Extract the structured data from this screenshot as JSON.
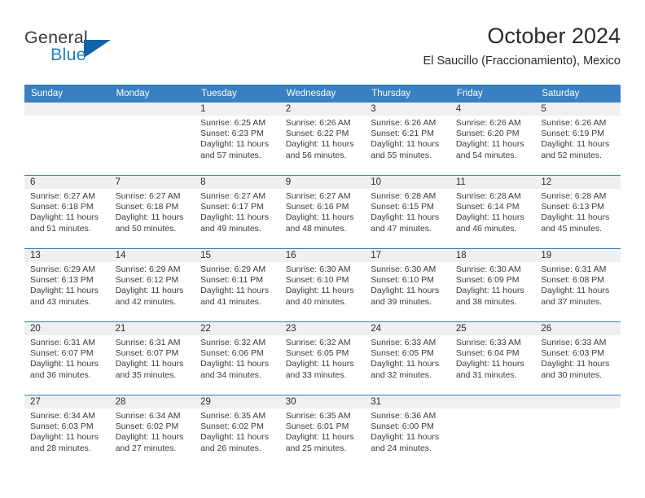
{
  "brand": {
    "line1": "General",
    "line2": "Blue",
    "triangle_icon": "triangle-icon",
    "accent_color": "#1263a8"
  },
  "header": {
    "month_title": "October 2024",
    "location": "El Saucillo (Fraccionamiento), Mexico"
  },
  "calendar": {
    "header_bg": "#3a7fc1",
    "daynum_bg": "#f0f0f0",
    "weekday_headers": [
      "Sunday",
      "Monday",
      "Tuesday",
      "Wednesday",
      "Thursday",
      "Friday",
      "Saturday"
    ],
    "weeks": [
      [
        {
          "day": "",
          "sunrise": "",
          "sunset": "",
          "daylight1": "",
          "daylight2": ""
        },
        {
          "day": "",
          "sunrise": "",
          "sunset": "",
          "daylight1": "",
          "daylight2": ""
        },
        {
          "day": "1",
          "sunrise": "Sunrise: 6:25 AM",
          "sunset": "Sunset: 6:23 PM",
          "daylight1": "Daylight: 11 hours",
          "daylight2": "and 57 minutes."
        },
        {
          "day": "2",
          "sunrise": "Sunrise: 6:26 AM",
          "sunset": "Sunset: 6:22 PM",
          "daylight1": "Daylight: 11 hours",
          "daylight2": "and 56 minutes."
        },
        {
          "day": "3",
          "sunrise": "Sunrise: 6:26 AM",
          "sunset": "Sunset: 6:21 PM",
          "daylight1": "Daylight: 11 hours",
          "daylight2": "and 55 minutes."
        },
        {
          "day": "4",
          "sunrise": "Sunrise: 6:26 AM",
          "sunset": "Sunset: 6:20 PM",
          "daylight1": "Daylight: 11 hours",
          "daylight2": "and 54 minutes."
        },
        {
          "day": "5",
          "sunrise": "Sunrise: 6:26 AM",
          "sunset": "Sunset: 6:19 PM",
          "daylight1": "Daylight: 11 hours",
          "daylight2": "and 52 minutes."
        }
      ],
      [
        {
          "day": "6",
          "sunrise": "Sunrise: 6:27 AM",
          "sunset": "Sunset: 6:18 PM",
          "daylight1": "Daylight: 11 hours",
          "daylight2": "and 51 minutes."
        },
        {
          "day": "7",
          "sunrise": "Sunrise: 6:27 AM",
          "sunset": "Sunset: 6:18 PM",
          "daylight1": "Daylight: 11 hours",
          "daylight2": "and 50 minutes."
        },
        {
          "day": "8",
          "sunrise": "Sunrise: 6:27 AM",
          "sunset": "Sunset: 6:17 PM",
          "daylight1": "Daylight: 11 hours",
          "daylight2": "and 49 minutes."
        },
        {
          "day": "9",
          "sunrise": "Sunrise: 6:27 AM",
          "sunset": "Sunset: 6:16 PM",
          "daylight1": "Daylight: 11 hours",
          "daylight2": "and 48 minutes."
        },
        {
          "day": "10",
          "sunrise": "Sunrise: 6:28 AM",
          "sunset": "Sunset: 6:15 PM",
          "daylight1": "Daylight: 11 hours",
          "daylight2": "and 47 minutes."
        },
        {
          "day": "11",
          "sunrise": "Sunrise: 6:28 AM",
          "sunset": "Sunset: 6:14 PM",
          "daylight1": "Daylight: 11 hours",
          "daylight2": "and 46 minutes."
        },
        {
          "day": "12",
          "sunrise": "Sunrise: 6:28 AM",
          "sunset": "Sunset: 6:13 PM",
          "daylight1": "Daylight: 11 hours",
          "daylight2": "and 45 minutes."
        }
      ],
      [
        {
          "day": "13",
          "sunrise": "Sunrise: 6:29 AM",
          "sunset": "Sunset: 6:13 PM",
          "daylight1": "Daylight: 11 hours",
          "daylight2": "and 43 minutes."
        },
        {
          "day": "14",
          "sunrise": "Sunrise: 6:29 AM",
          "sunset": "Sunset: 6:12 PM",
          "daylight1": "Daylight: 11 hours",
          "daylight2": "and 42 minutes."
        },
        {
          "day": "15",
          "sunrise": "Sunrise: 6:29 AM",
          "sunset": "Sunset: 6:11 PM",
          "daylight1": "Daylight: 11 hours",
          "daylight2": "and 41 minutes."
        },
        {
          "day": "16",
          "sunrise": "Sunrise: 6:30 AM",
          "sunset": "Sunset: 6:10 PM",
          "daylight1": "Daylight: 11 hours",
          "daylight2": "and 40 minutes."
        },
        {
          "day": "17",
          "sunrise": "Sunrise: 6:30 AM",
          "sunset": "Sunset: 6:10 PM",
          "daylight1": "Daylight: 11 hours",
          "daylight2": "and 39 minutes."
        },
        {
          "day": "18",
          "sunrise": "Sunrise: 6:30 AM",
          "sunset": "Sunset: 6:09 PM",
          "daylight1": "Daylight: 11 hours",
          "daylight2": "and 38 minutes."
        },
        {
          "day": "19",
          "sunrise": "Sunrise: 6:31 AM",
          "sunset": "Sunset: 6:08 PM",
          "daylight1": "Daylight: 11 hours",
          "daylight2": "and 37 minutes."
        }
      ],
      [
        {
          "day": "20",
          "sunrise": "Sunrise: 6:31 AM",
          "sunset": "Sunset: 6:07 PM",
          "daylight1": "Daylight: 11 hours",
          "daylight2": "and 36 minutes."
        },
        {
          "day": "21",
          "sunrise": "Sunrise: 6:31 AM",
          "sunset": "Sunset: 6:07 PM",
          "daylight1": "Daylight: 11 hours",
          "daylight2": "and 35 minutes."
        },
        {
          "day": "22",
          "sunrise": "Sunrise: 6:32 AM",
          "sunset": "Sunset: 6:06 PM",
          "daylight1": "Daylight: 11 hours",
          "daylight2": "and 34 minutes."
        },
        {
          "day": "23",
          "sunrise": "Sunrise: 6:32 AM",
          "sunset": "Sunset: 6:05 PM",
          "daylight1": "Daylight: 11 hours",
          "daylight2": "and 33 minutes."
        },
        {
          "day": "24",
          "sunrise": "Sunrise: 6:33 AM",
          "sunset": "Sunset: 6:05 PM",
          "daylight1": "Daylight: 11 hours",
          "daylight2": "and 32 minutes."
        },
        {
          "day": "25",
          "sunrise": "Sunrise: 6:33 AM",
          "sunset": "Sunset: 6:04 PM",
          "daylight1": "Daylight: 11 hours",
          "daylight2": "and 31 minutes."
        },
        {
          "day": "26",
          "sunrise": "Sunrise: 6:33 AM",
          "sunset": "Sunset: 6:03 PM",
          "daylight1": "Daylight: 11 hours",
          "daylight2": "and 30 minutes."
        }
      ],
      [
        {
          "day": "27",
          "sunrise": "Sunrise: 6:34 AM",
          "sunset": "Sunset: 6:03 PM",
          "daylight1": "Daylight: 11 hours",
          "daylight2": "and 28 minutes."
        },
        {
          "day": "28",
          "sunrise": "Sunrise: 6:34 AM",
          "sunset": "Sunset: 6:02 PM",
          "daylight1": "Daylight: 11 hours",
          "daylight2": "and 27 minutes."
        },
        {
          "day": "29",
          "sunrise": "Sunrise: 6:35 AM",
          "sunset": "Sunset: 6:02 PM",
          "daylight1": "Daylight: 11 hours",
          "daylight2": "and 26 minutes."
        },
        {
          "day": "30",
          "sunrise": "Sunrise: 6:35 AM",
          "sunset": "Sunset: 6:01 PM",
          "daylight1": "Daylight: 11 hours",
          "daylight2": "and 25 minutes."
        },
        {
          "day": "31",
          "sunrise": "Sunrise: 6:36 AM",
          "sunset": "Sunset: 6:00 PM",
          "daylight1": "Daylight: 11 hours",
          "daylight2": "and 24 minutes."
        },
        {
          "day": "",
          "sunrise": "",
          "sunset": "",
          "daylight1": "",
          "daylight2": ""
        },
        {
          "day": "",
          "sunrise": "",
          "sunset": "",
          "daylight1": "",
          "daylight2": ""
        }
      ]
    ]
  }
}
